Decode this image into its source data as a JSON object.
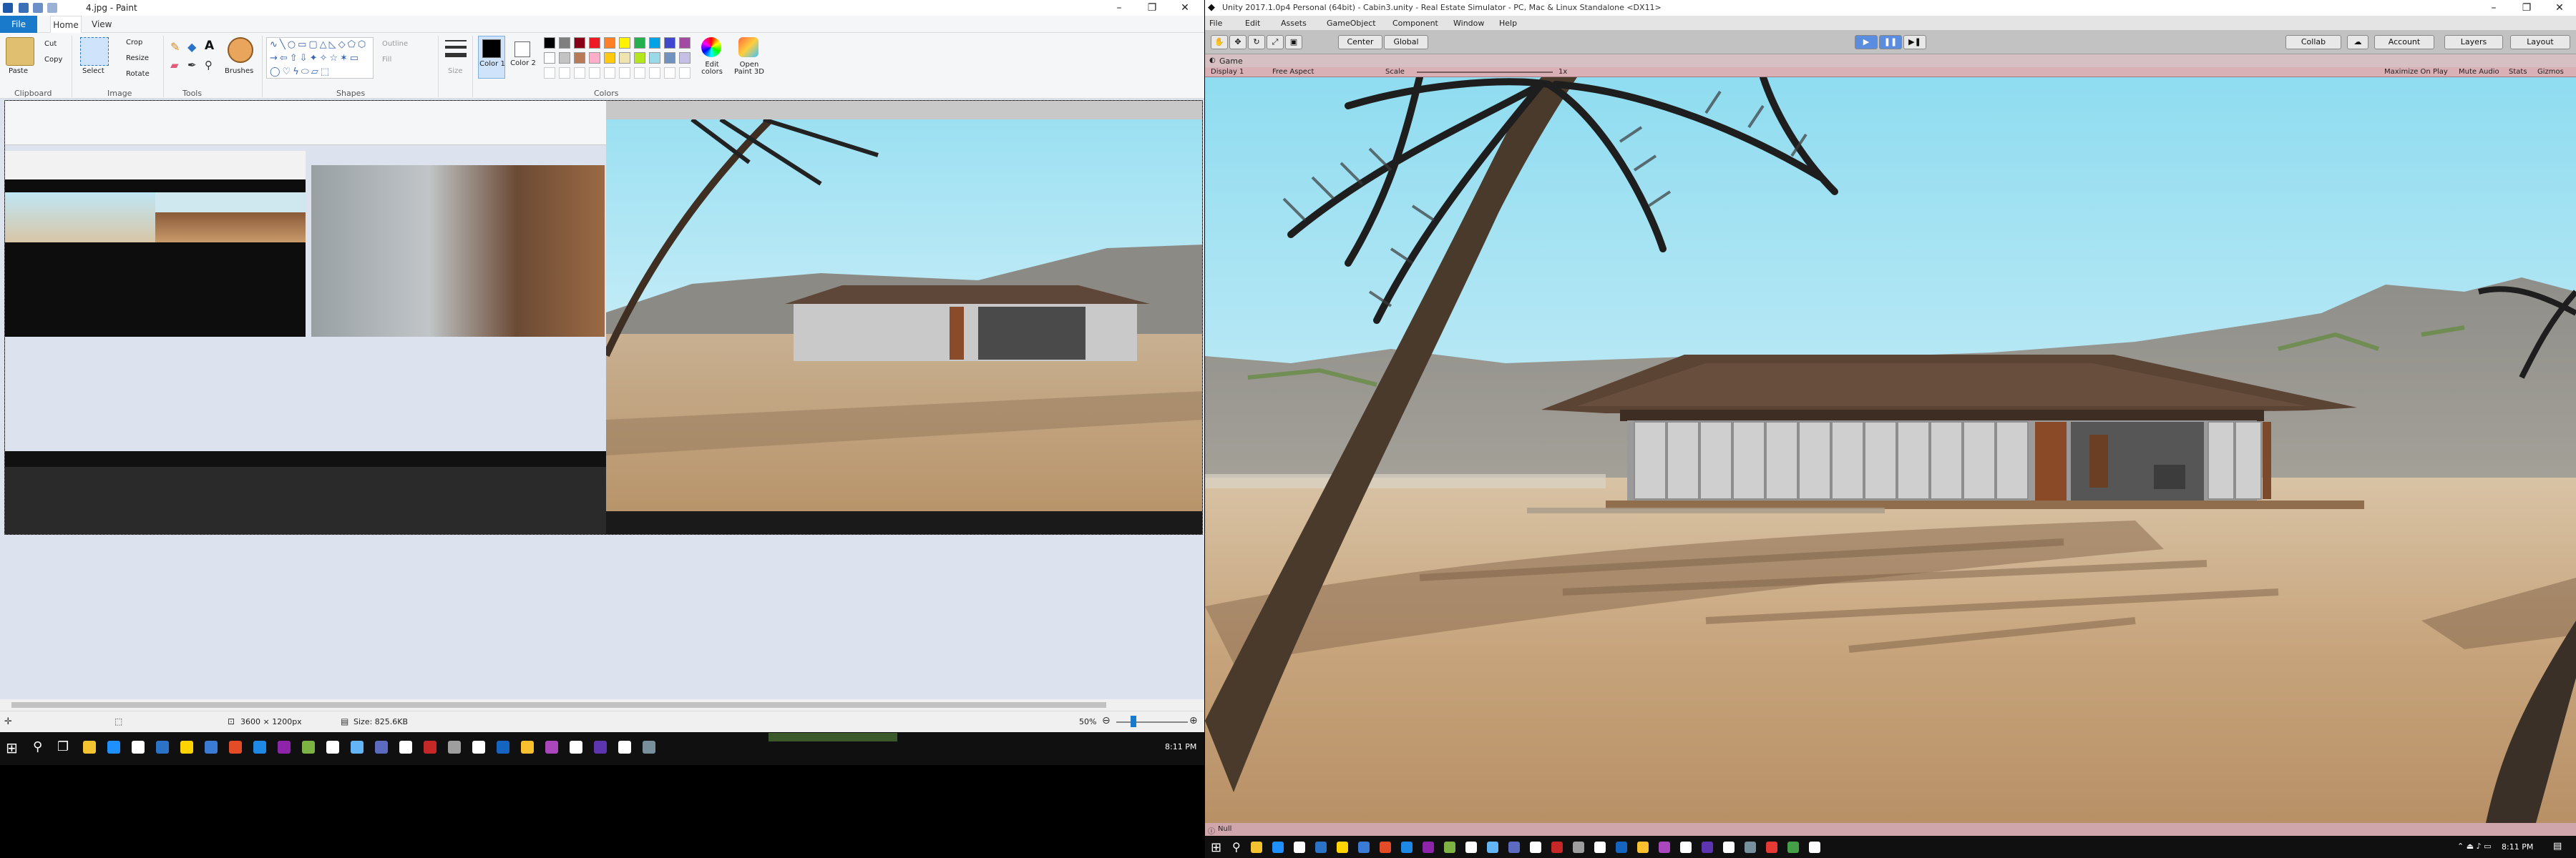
{
  "paint": {
    "title": "4.jpg - Paint",
    "menu": {
      "file": "File",
      "home": "Home",
      "view": "View"
    },
    "groups": {
      "clipboard": "Clipboard",
      "image": "Image",
      "tools": "Tools",
      "shapes": "Shapes",
      "colors": "Colors"
    },
    "buttons": {
      "paste": "Paste",
      "cut": "Cut",
      "copy": "Copy",
      "select": "Select",
      "crop": "Crop",
      "resize": "Resize",
      "rotate": "Rotate",
      "brushes": "Brushes",
      "outline": "Outline",
      "fill": "Fill",
      "size": "Size",
      "color1": "Color 1",
      "color2": "Color 2",
      "edit_colors": "Edit colors",
      "open_paint3d": "Open Paint 3D"
    },
    "palette": [
      "#000000",
      "#7f7f7f",
      "#880015",
      "#ed1c24",
      "#ff7f27",
      "#fff200",
      "#22b14c",
      "#00a2e8",
      "#3f48cc",
      "#a349a4",
      "#ffffff",
      "#c3c3c3",
      "#b97a57",
      "#ffaec9",
      "#ffc90e",
      "#efe4b0",
      "#b5e61d",
      "#99d9ea",
      "#7092be",
      "#c8bfe7"
    ],
    "status": {
      "dimensions": "3600 × 1200px",
      "size": "Size: 825.6KB",
      "zoom": "50%"
    }
  },
  "taskbar_left": {
    "time": "8:11 PM"
  },
  "unity": {
    "title": "Unity 2017.1.0p4 Personal (64bit) - Cabin3.unity - Real Estate Simulator - PC, Mac & Linux Standalone <DX11>",
    "menu": [
      "File",
      "Edit",
      "Assets",
      "GameObject",
      "Component",
      "Window",
      "Help"
    ],
    "toolbar": {
      "center": "Center",
      "global": "Global",
      "collab": "Collab",
      "account": "Account",
      "layers": "Layers",
      "layout": "Layout"
    },
    "game_tab": "Game",
    "gamebar": {
      "display": "Display 1",
      "aspect": "Free Aspect",
      "scale_label": "Scale",
      "scale_value": "1x",
      "maximize": "Maximize On Play",
      "mute": "Mute Audio",
      "stats": "Stats",
      "gizmos": "Gizmos"
    },
    "status": "Null",
    "time": "8:11 PM"
  }
}
